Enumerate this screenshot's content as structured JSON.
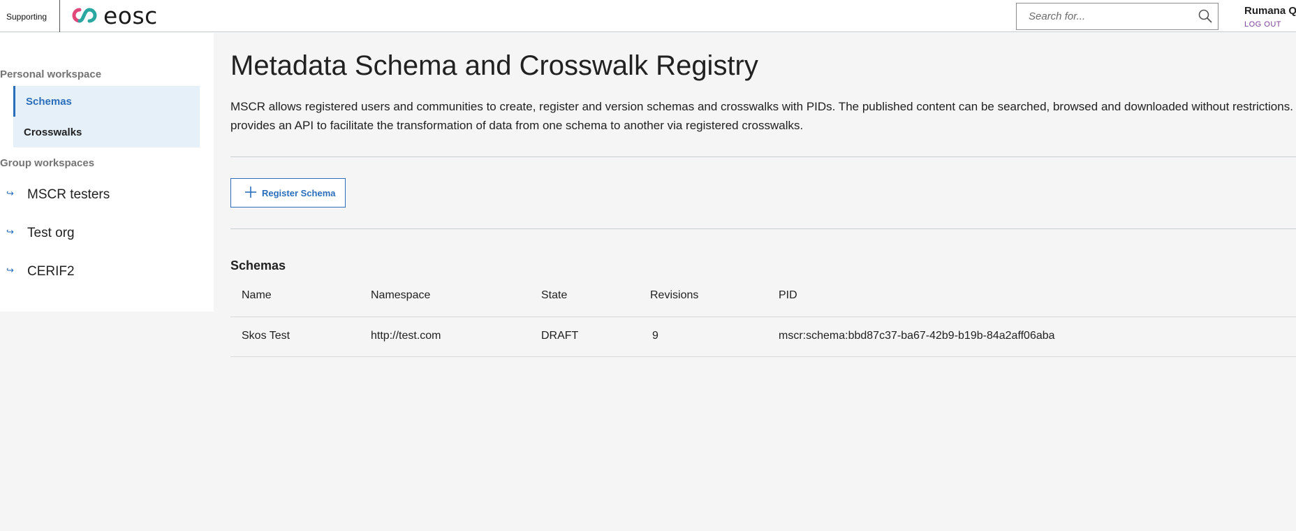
{
  "header": {
    "supporting": "Supporting",
    "logo_text": "eosc",
    "search_placeholder": "Search for...",
    "user_name": "Rumana Qu",
    "logout": "LOG OUT"
  },
  "sidebar": {
    "personal_label": "Personal workspace",
    "personal_items": [
      {
        "label": "Schemas",
        "active": true
      },
      {
        "label": "Crosswalks",
        "active": false
      }
    ],
    "group_label": "Group workspaces",
    "groups": [
      {
        "label": "MSCR testers",
        "icon": "arrow-hook-icon"
      },
      {
        "label": "Test org",
        "icon": "arrow-hook-icon"
      },
      {
        "label": "CERIF2",
        "icon": "arrow-hook-icon"
      }
    ]
  },
  "main": {
    "title": "Metadata Schema and Crosswalk Registry",
    "intro_line1": "MSCR allows registered users and communities to create, register and version schemas and crosswalks with PIDs. The published content can be searched, browsed and downloaded without restrictions. MS",
    "intro_line2": "provides an API to facilitate the transformation of data from one schema to another via registered crosswalks.",
    "register_button": "Register Schema",
    "schemas_heading": "Schemas",
    "table": {
      "columns": [
        "Name",
        "Namespace",
        "State",
        "Revisions",
        "PID"
      ],
      "rows": [
        [
          "Skos Test",
          "http://test.com",
          "DRAFT",
          "9",
          "mscr:schema:bbd87c37-ba67-42b9-b19b-84a2aff06aba"
        ]
      ]
    }
  },
  "colors": {
    "accent": "#2a6ebb",
    "logout": "#7b3f99",
    "nav_active_bg": "#e6f0f8",
    "page_bg": "#f5f5f5"
  }
}
